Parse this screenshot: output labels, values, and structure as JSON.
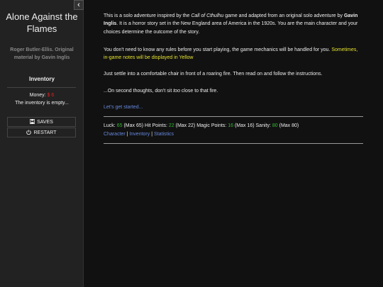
{
  "sidebar": {
    "toggle_glyph": "‹",
    "title": "Alone Against the Flames",
    "author": "Roger Butler-Ellis. Original material by Gavin Inglis",
    "inventory_heading": "Inventory",
    "money_label": "Money:",
    "money_value": "$ 6",
    "inventory_empty": "The inventory is empty...",
    "saves_label": "SAVES",
    "restart_label": "RESTART",
    "icons": {
      "saves": "floppy-disk-icon",
      "restart": "power-icon"
    }
  },
  "passage": {
    "p1": {
      "a": "This is a solo adventure inspired by the ",
      "b": "Call of Cthulhu",
      "c": " game and adapted from an original solo adventure by ",
      "d": "Gavin Inglis",
      "e": ". It is a horror story set in the New England area of America in the 1920s. You are the main character and your choices determine the outcome of the story."
    },
    "p2": {
      "a": "You don't need to know any rules before you start playing, the game mechanics will be handled for you. ",
      "b": "Sometimes, in-game notes will be displayed in Yellow"
    },
    "p3": "Just settle into a comfortable chair in front of a roaring fire. Then read on and follow the instructions.",
    "p4": {
      "a": "...On second thoughts, don't sit ",
      "b": "too",
      "c": " close to that fire."
    },
    "start_link": "Let's get started..."
  },
  "stats": {
    "luck_label": "Luck:",
    "luck_value": "65",
    "luck_max": "(Max 65)",
    "hp_label": "Hit Points:",
    "hp_value": "22",
    "hp_max": "(Max 22)",
    "mp_label": "Magic Points:",
    "mp_value": "16",
    "mp_max": "(Max 16)",
    "san_label": "Sanity:",
    "san_value": "80",
    "san_max": "(Max 80)",
    "links": {
      "character": "Character",
      "inventory": "Inventory",
      "statistics": "Statistics"
    },
    "separator": "|"
  },
  "colors": {
    "background": "#111111",
    "sidebar": "#222222",
    "text": "#eeeeee",
    "link": "#6688dd",
    "note_yellow": "#e6e22e",
    "stat_green": "#33bb33",
    "money_red": "#e02020"
  }
}
